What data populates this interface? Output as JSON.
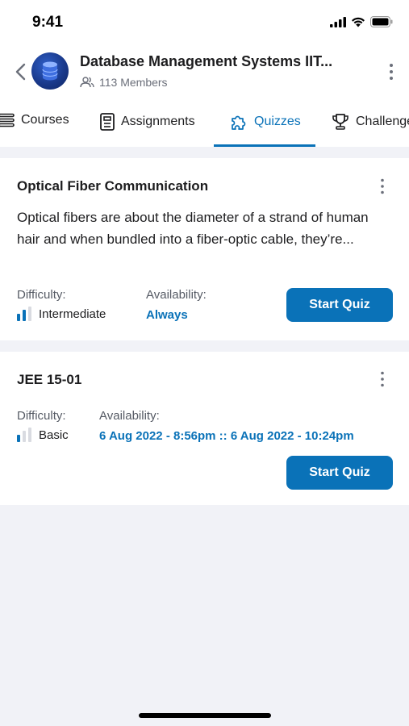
{
  "status_bar": {
    "time": "9:41"
  },
  "header": {
    "title": "Database Management Systems IIT...",
    "members": "113 Members"
  },
  "tabs": [
    {
      "label": "Courses",
      "icon": "list-icon"
    },
    {
      "label": "Assignments",
      "icon": "document-icon"
    },
    {
      "label": "Quizzes",
      "icon": "puzzle-icon",
      "active": true
    },
    {
      "label": "Challenge",
      "icon": "trophy-icon"
    }
  ],
  "quizzes": [
    {
      "title": "Optical Fiber Communication",
      "description": "Optical fibers are about the diameter of a strand of human hair and when bundled into a fiber-optic cable, they’re...",
      "difficulty_label": "Difficulty:",
      "difficulty": "Intermediate",
      "difficulty_level": 2,
      "availability_label": "Availability:",
      "availability": "Always",
      "button": "Start Quiz"
    },
    {
      "title": "JEE 15-01",
      "difficulty_label": "Difficulty:",
      "difficulty": "Basic",
      "difficulty_level": 1,
      "availability_label": "Availability:",
      "availability": "6 Aug 2022 - 8:56pm :: 6 Aug 2022 - 10:24pm",
      "button": "Start Quiz"
    }
  ],
  "colors": {
    "accent": "#0a72b8",
    "background": "#f1f2f7"
  }
}
